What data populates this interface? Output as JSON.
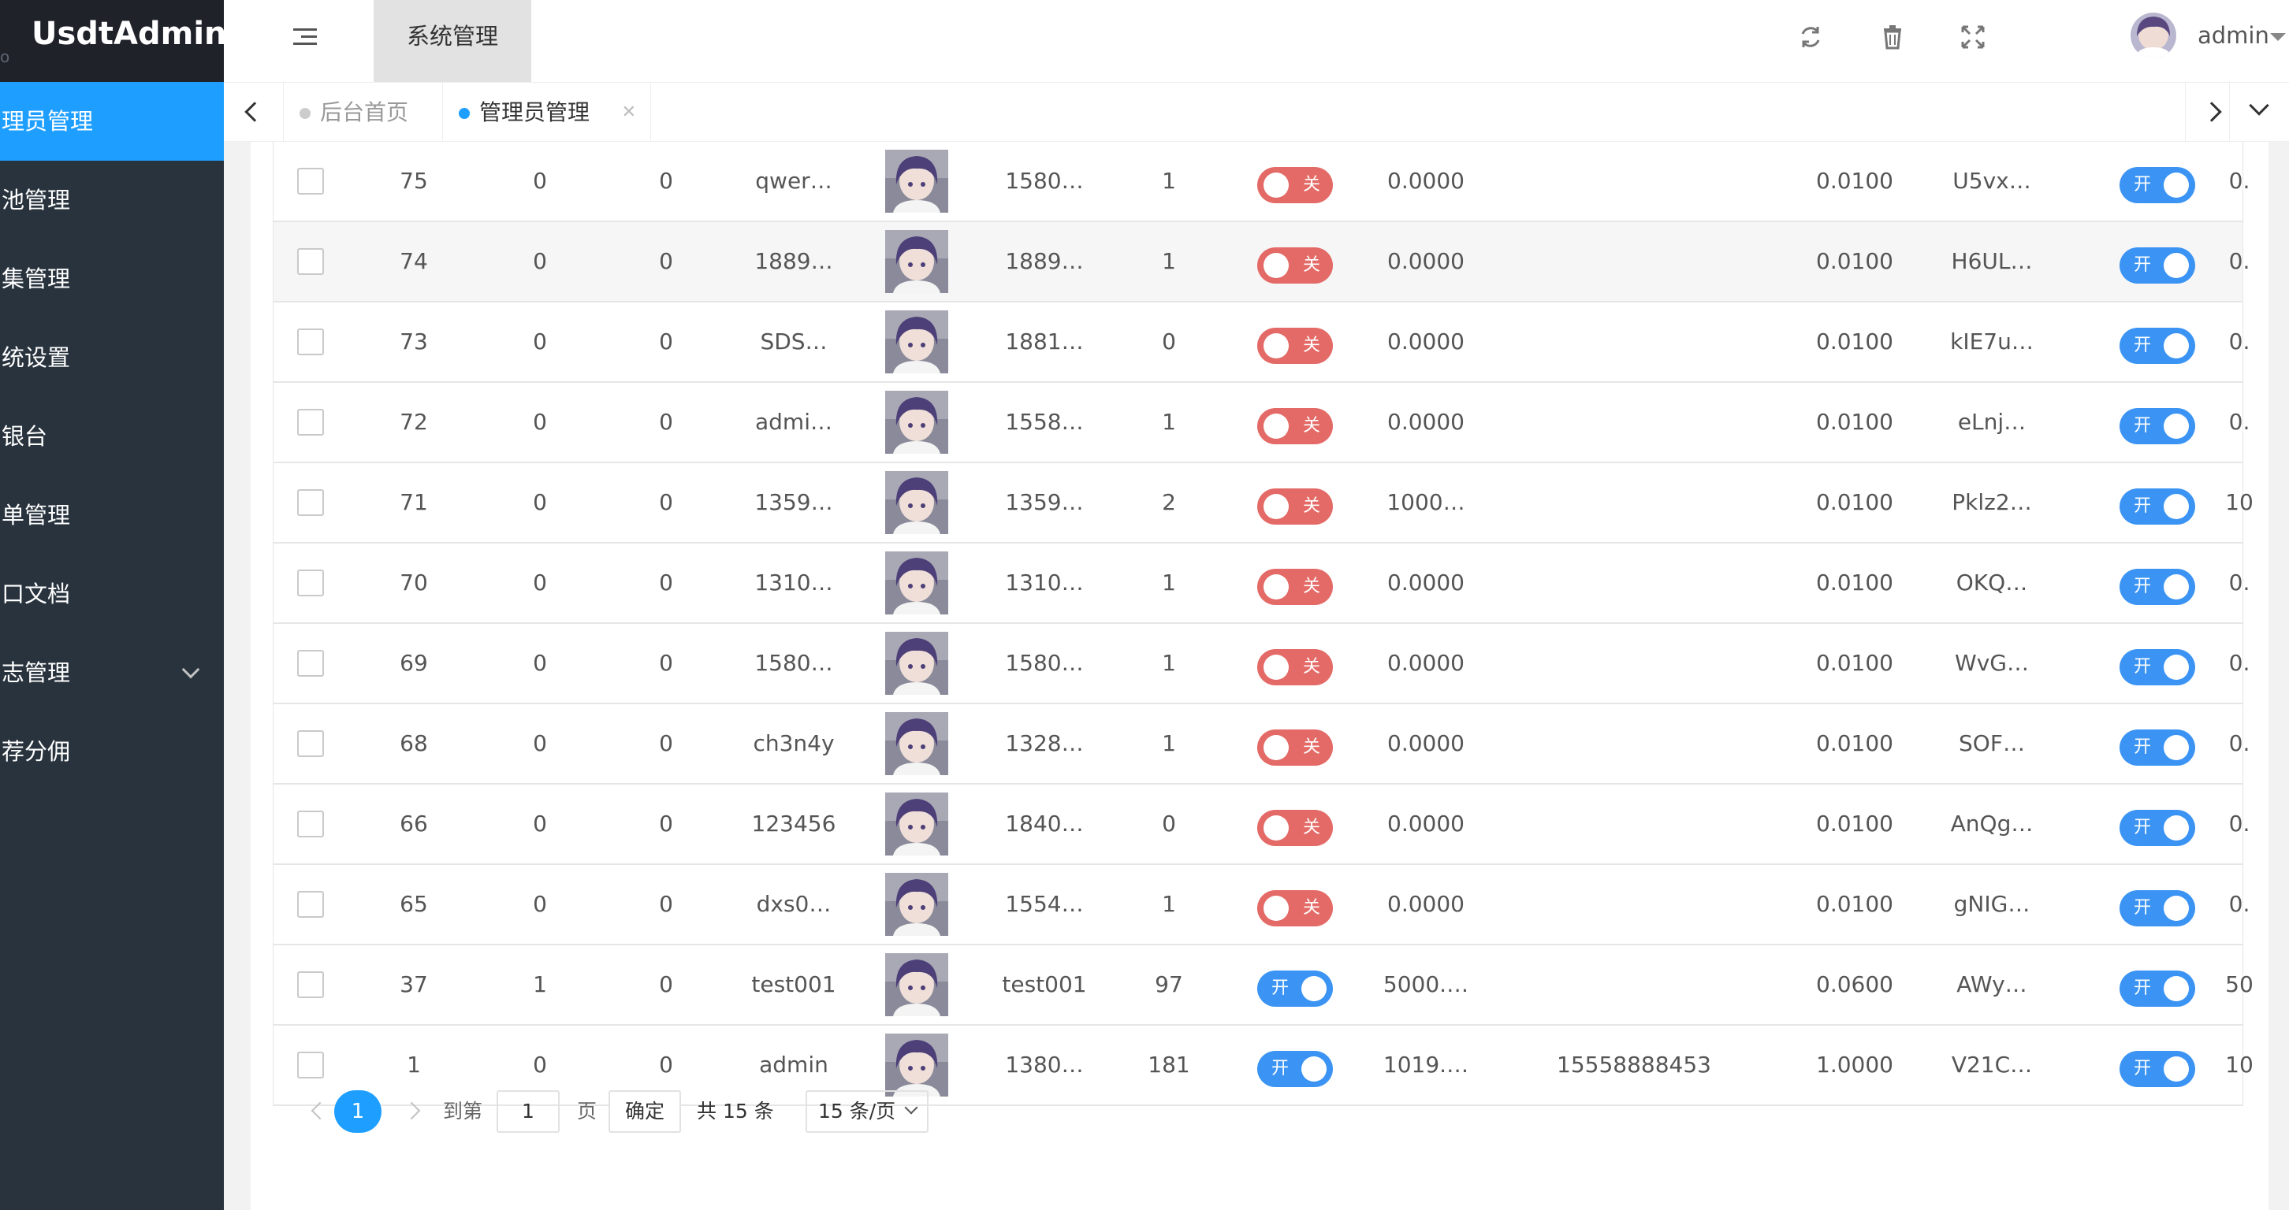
{
  "app": {
    "logo": "UsdtAdmin",
    "logo_dot": "o"
  },
  "sidebar": {
    "items": [
      {
        "label": "理员管理",
        "active": true
      },
      {
        "label": "池管理"
      },
      {
        "label": "集管理"
      },
      {
        "label": "统设置"
      },
      {
        "label": "银台"
      },
      {
        "label": "单管理"
      },
      {
        "label": "口文档"
      },
      {
        "label": "志管理",
        "has_submenu": true
      },
      {
        "label": "荐分佣"
      }
    ]
  },
  "header": {
    "top_tab": "系统管理",
    "icons": [
      "refresh-icon",
      "trash-icon",
      "fullscreen-icon"
    ],
    "user_name": "admin"
  },
  "tabs": [
    {
      "label": "后台首页",
      "active": false
    },
    {
      "label": "管理员管理",
      "active": true
    }
  ],
  "table": {
    "rows": [
      {
        "id": "75",
        "c2": "0",
        "c3": "0",
        "name": "qwer…",
        "phone": "1580…",
        "count": "1",
        "switch1": "关",
        "balance": "0.0000",
        "extra": "",
        "rate": "0.0100",
        "key": "U5vx…",
        "switch2": "开",
        "last": "0."
      },
      {
        "id": "74",
        "c2": "0",
        "c3": "0",
        "name": "1889…",
        "phone": "1889…",
        "count": "1",
        "switch1": "关",
        "balance": "0.0000",
        "extra": "",
        "rate": "0.0100",
        "key": "H6UL…",
        "switch2": "开",
        "last": "0."
      },
      {
        "id": "73",
        "c2": "0",
        "c3": "0",
        "name": "SDS…",
        "phone": "1881…",
        "count": "0",
        "switch1": "关",
        "balance": "0.0000",
        "extra": "",
        "rate": "0.0100",
        "key": "kIE7u…",
        "switch2": "开",
        "last": "0."
      },
      {
        "id": "72",
        "c2": "0",
        "c3": "0",
        "name": "admi…",
        "phone": "1558…",
        "count": "1",
        "switch1": "关",
        "balance": "0.0000",
        "extra": "",
        "rate": "0.0100",
        "key": "eLnj…",
        "switch2": "开",
        "last": "0."
      },
      {
        "id": "71",
        "c2": "0",
        "c3": "0",
        "name": "1359…",
        "phone": "1359…",
        "count": "2",
        "switch1": "关",
        "balance": "1000…",
        "extra": "",
        "rate": "0.0100",
        "key": "Pklz2…",
        "switch2": "开",
        "last": "10"
      },
      {
        "id": "70",
        "c2": "0",
        "c3": "0",
        "name": "1310…",
        "phone": "1310…",
        "count": "1",
        "switch1": "关",
        "balance": "0.0000",
        "extra": "",
        "rate": "0.0100",
        "key": "OKQ…",
        "switch2": "开",
        "last": "0."
      },
      {
        "id": "69",
        "c2": "0",
        "c3": "0",
        "name": "1580…",
        "phone": "1580…",
        "count": "1",
        "switch1": "关",
        "balance": "0.0000",
        "extra": "",
        "rate": "0.0100",
        "key": "WvG…",
        "switch2": "开",
        "last": "0."
      },
      {
        "id": "68",
        "c2": "0",
        "c3": "0",
        "name": "ch3n4y",
        "phone": "1328…",
        "count": "1",
        "switch1": "关",
        "balance": "0.0000",
        "extra": "",
        "rate": "0.0100",
        "key": "SOF…",
        "switch2": "开",
        "last": "0."
      },
      {
        "id": "66",
        "c2": "0",
        "c3": "0",
        "name": "123456",
        "phone": "1840…",
        "count": "0",
        "switch1": "关",
        "balance": "0.0000",
        "extra": "",
        "rate": "0.0100",
        "key": "AnQg…",
        "switch2": "开",
        "last": "0."
      },
      {
        "id": "65",
        "c2": "0",
        "c3": "0",
        "name": "dxs0…",
        "phone": "1554…",
        "count": "1",
        "switch1": "关",
        "balance": "0.0000",
        "extra": "",
        "rate": "0.0100",
        "key": "gNIG…",
        "switch2": "开",
        "last": "0."
      },
      {
        "id": "37",
        "c2": "1",
        "c3": "0",
        "name": "test001",
        "phone": "test001",
        "count": "97",
        "switch1": "开",
        "balance": "5000.…",
        "extra": "",
        "rate": "0.0600",
        "key": "AWy…",
        "switch2": "开",
        "last": "50"
      },
      {
        "id": "1",
        "c2": "0",
        "c3": "0",
        "name": "admin",
        "phone": "1380…",
        "count": "181",
        "switch1": "开",
        "balance": "1019.…",
        "extra": "15558888453",
        "rate": "1.0000",
        "key": "V21C…",
        "switch2": "开",
        "last": "10"
      }
    ]
  },
  "pagination": {
    "current": "1",
    "goto_label": "到第",
    "page_input": "1",
    "page_unit": "页",
    "confirm": "确定",
    "total": "共 15 条",
    "page_size": "15 条/页"
  }
}
